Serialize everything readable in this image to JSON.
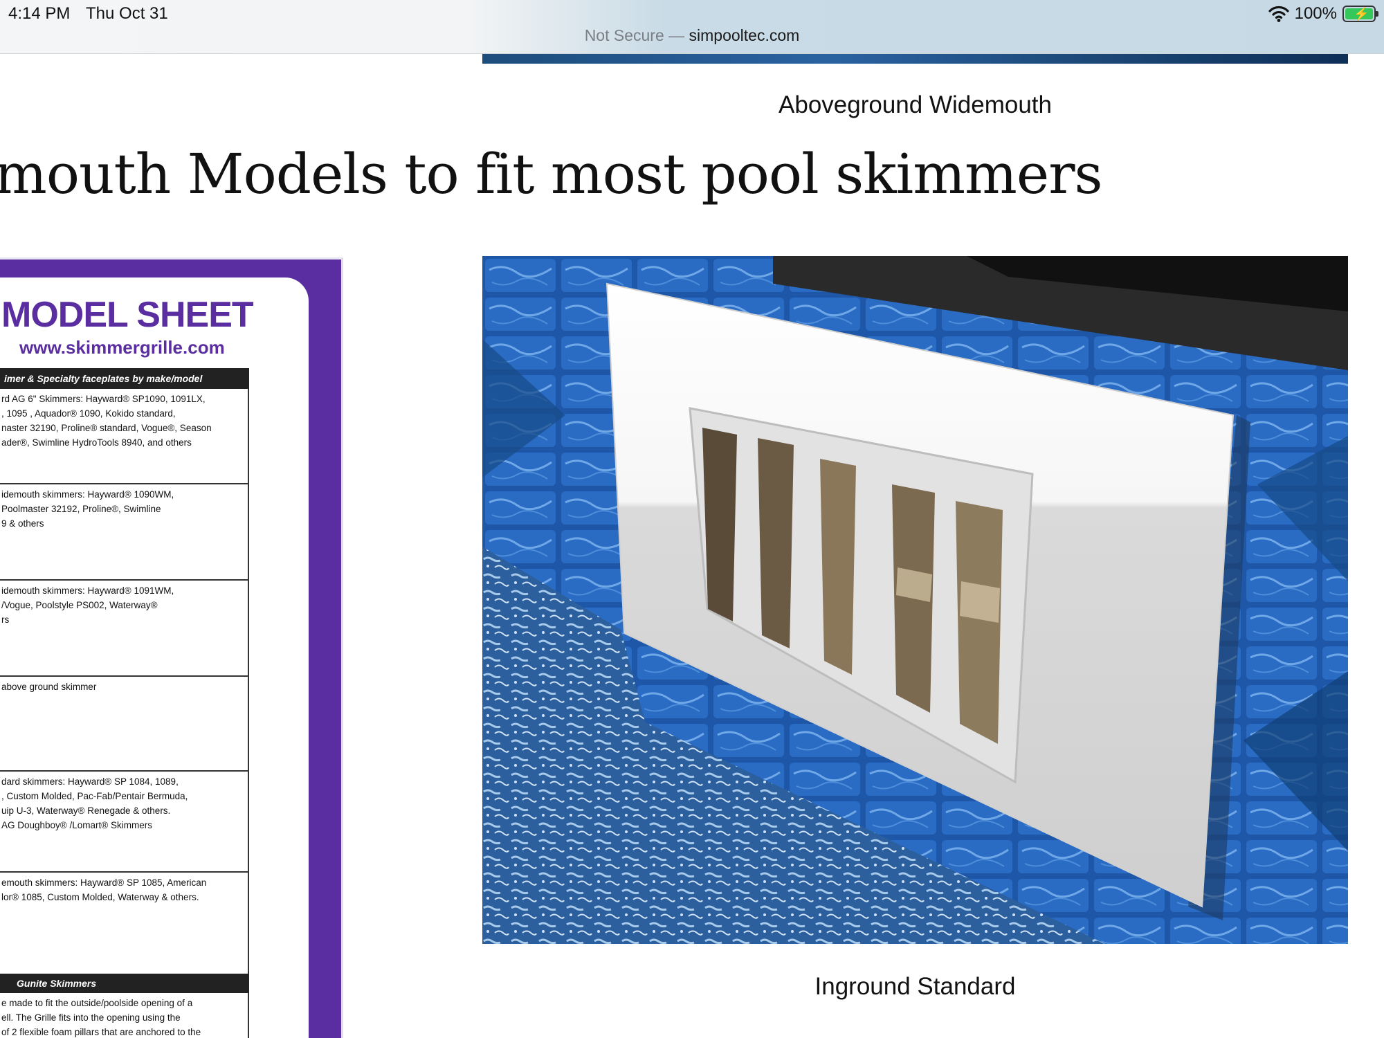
{
  "status": {
    "time": "4:14 PM",
    "date": "Thu Oct 31",
    "battery_percent": "100%",
    "wifi_icon": "wifi-icon",
    "battery_icon": "battery-charging-icon",
    "battery_level": 1.0
  },
  "urlbar": {
    "security": "Not Secure",
    "separator": " — ",
    "domain": "simpooltec.com"
  },
  "page": {
    "caption_top": "Aboveground Widemouth",
    "heading": "mouth Models to fit most pool skimmers",
    "caption_bottom": "Inground Standard"
  },
  "sheet": {
    "title": "MODEL SHEET",
    "url": "www.skimmergrille.com",
    "header_bar": "imer & Specialty faceplates by make/model",
    "rows": [
      {
        "lines": [
          "rd AG 6\" Skimmers:  Hayward® SP1090, 1091LX,",
          ", 1095 , Aquador® 1090, Kokido standard,",
          "naster 32190, Proline® standard,  Vogue®, Season",
          "ader®, Swimline HydroTools 8940,  and others"
        ]
      },
      {
        "lines": [
          "idemouth skimmers: Hayward® 1090WM,",
          "Poolmaster 32192, Proline®, Swimline",
          "9 & others"
        ]
      },
      {
        "lines": [
          "idemouth skimmers: Hayward® 1091WM,",
          "/Vogue, Poolstyle PS002, Waterway®",
          "rs"
        ]
      },
      {
        "lines": [
          "above ground skimmer"
        ]
      },
      {
        "lines": [
          "dard skimmers: Hayward® SP 1084, 1089,",
          ", Custom Molded, Pac-Fab/Pentair Bermuda,",
          "uip U-3, Waterway® Renegade & others.",
          " AG Doughboy® /Lomart® Skimmers"
        ]
      },
      {
        "lines": [
          "emouth skimmers: Hayward® SP 1085, American",
          "lor® 1085, Custom Molded, Waterway & others."
        ]
      }
    ],
    "gunite_bar": "Gunite Skimmers",
    "gunite_lines": [
      "e made to fit the outside/poolside opening of a",
      "ell. The Grille fits into the opening using the",
      "of 2 flexible foam pillars that are anchored to the"
    ]
  }
}
